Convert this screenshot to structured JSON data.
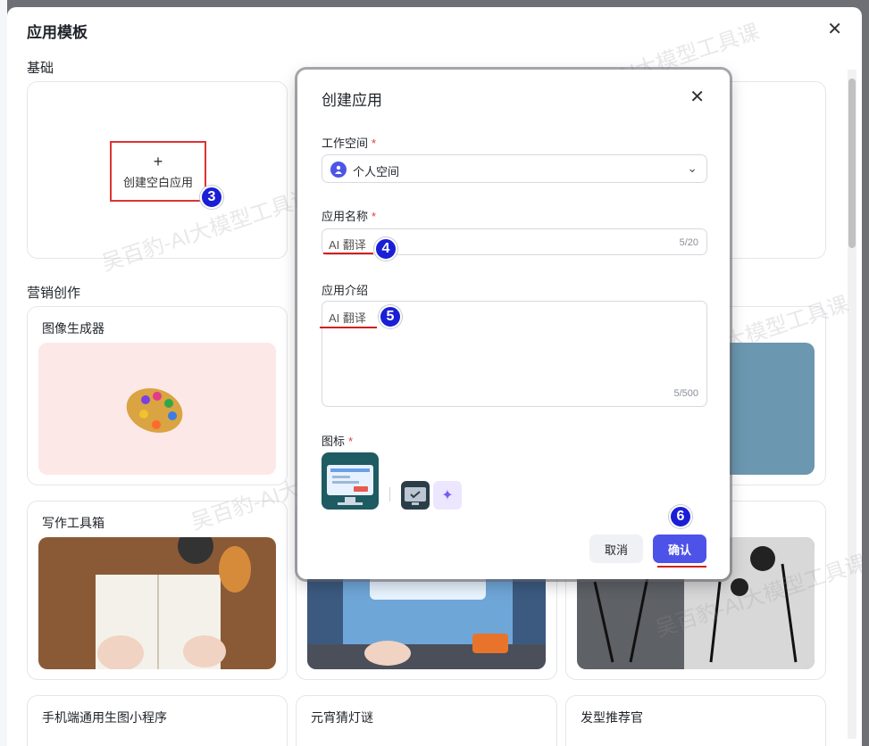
{
  "outer": {
    "title": "应用模板",
    "close_glyph": "✕",
    "sections": {
      "basic": "基础",
      "marketing": "营销创作"
    },
    "blank_card": {
      "plus": "+",
      "label": "创建空白应用"
    },
    "cards": [
      {
        "title": "图像生成器"
      },
      {
        "title": "写作工具箱"
      },
      {
        "title": "手机端通用生图小程序"
      },
      {
        "title": "元宵猜灯谜"
      },
      {
        "title": "发型推荐官"
      }
    ]
  },
  "dialog": {
    "title": "创建应用",
    "close_glyph": "✕",
    "workspace": {
      "label": "工作空间",
      "required": "*",
      "value": "个人空间",
      "chevron": "⌄"
    },
    "app_name": {
      "label": "应用名称",
      "required": "*",
      "value": "AI 翻译",
      "counter": "5/20"
    },
    "app_intro": {
      "label": "应用介绍",
      "value": "AI 翻译",
      "counter": "5/500"
    },
    "icon": {
      "label": "图标",
      "required": "*",
      "generate_glyph": "✦"
    },
    "cancel_label": "取消",
    "confirm_label": "确认"
  },
  "steps": [
    "3",
    "4",
    "5",
    "6"
  ],
  "watermark": "吴百豹-AI大模型工具课",
  "colors": {
    "primary": "#4d53e8",
    "step": "#1a1fd6",
    "highlight_red": "#d33"
  }
}
